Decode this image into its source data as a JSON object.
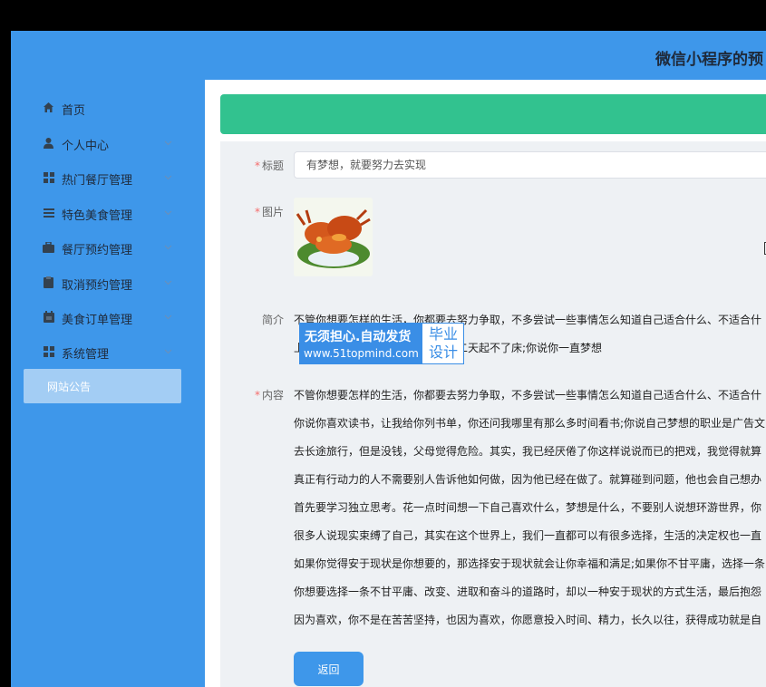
{
  "app": {
    "title": "微信小程序的预"
  },
  "sidebar": {
    "items": [
      {
        "label": "首页",
        "icon": "home-icon"
      },
      {
        "label": "个人中心",
        "icon": "user-icon"
      },
      {
        "label": "热门餐厅管理",
        "icon": "grid-icon"
      },
      {
        "label": "特色美食管理",
        "icon": "list-icon"
      },
      {
        "label": "餐厅预约管理",
        "icon": "briefcase-icon"
      },
      {
        "label": "取消预约管理",
        "icon": "clipboard-icon"
      },
      {
        "label": "美食订单管理",
        "icon": "calendar-icon"
      },
      {
        "label": "系统管理",
        "icon": "grid-icon"
      }
    ],
    "active_item": {
      "label": "网站公告"
    }
  },
  "form": {
    "title_label": "标题",
    "title_value": "有梦想，就要努力去实现",
    "image_label": "图片",
    "intro_label": "简介",
    "intro_lines": [
      "不管你想要怎样的生活，你都要去努力争取，不多尝试一些事情怎么知道自己适合什么、不适合什",
      "            上到、工作辛苦或者身体不舒服第二天起不了床;你说你一直梦想"
    ],
    "content_label": "内容",
    "content_lines": [
      "不管你想要怎样的生活，你都要去努力争取，不多尝试一些事情怎么知道自己适合什么、不适合什",
      "你说你喜欢读书，让我给你列书单，你还问我哪里有那么多时间看书;你说自己梦想的职业是广告文",
      "去长途旅行，但是没钱，父母觉得危险。其实，我已经厌倦了你这样说说而已的把戏，我觉得就算",
      "真正有行动力的人不需要别人告诉他如何做，因为他已经在做了。就算碰到问题，他也会自己想办",
      "首先要学习独立思考。花一点时间想一下自己喜欢什么，梦想是什么，不要别人说想环游世界，你",
      "很多人说现实束缚了自己，其实在这个世界上，我们一直都可以有很多选择，生活的决定权也一直",
      "如果你觉得安于现状是你想要的，那选择安于现状就会让你幸福和满足;如果你不甘平庸，选择一条",
      "你想要选择一条不甘平庸、改变、进取和奋斗的道路时，却以一种安于现状的方式生活，最后抱怨",
      "因为喜欢，你不是在苦苦坚持，也因为喜欢，你愿意投入时间、精力，长久以往，获得成功就是自"
    ],
    "back_label": "返回"
  },
  "watermark": {
    "line1": "无须担心.自动发货",
    "line2": "www.51topmind.com",
    "right_text": "毕业设计"
  },
  "colors": {
    "topbar": "#3e97ea",
    "sidebar": "#3e97ea",
    "active_item": "#a3cdf4",
    "green_bar": "#32c28f",
    "required": "#f56c6c",
    "button": "#3e97ea"
  }
}
